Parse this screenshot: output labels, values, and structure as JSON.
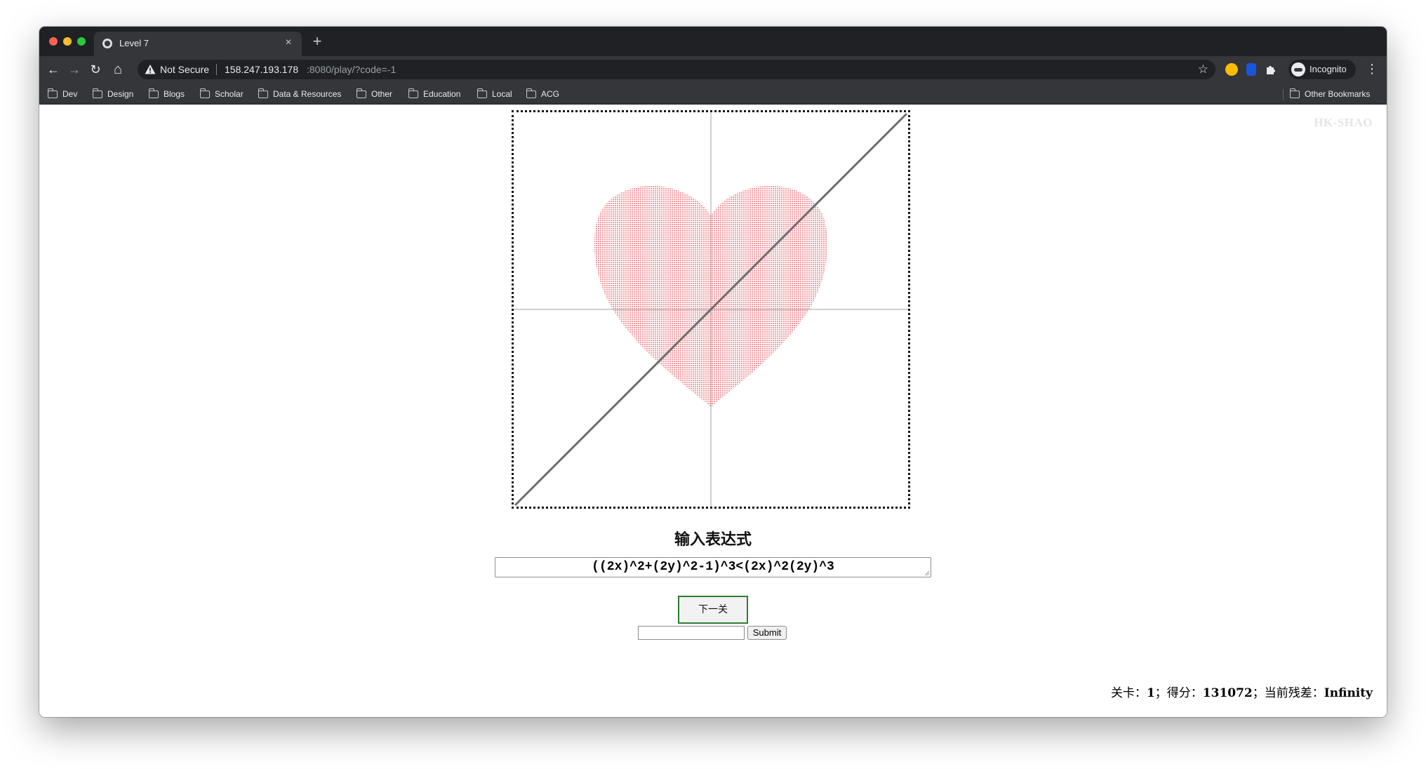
{
  "tab": {
    "title": "Level 7",
    "close_glyph": "×",
    "new_tab_glyph": "+"
  },
  "toolbar": {
    "back_glyph": "←",
    "forward_glyph": "→",
    "reload_glyph": "↻",
    "home_glyph": "⌂",
    "security_label": "Not Secure",
    "url_host": "158.247.193.178",
    "url_rest": ":8080/play/?code=-1",
    "star_glyph": "☆",
    "profile_label": "Incognito",
    "menu_glyph": "⋮"
  },
  "bookmarks": {
    "items": [
      "Dev",
      "Design",
      "Blogs",
      "Scholar",
      "Data & Resources",
      "Other",
      "Education",
      "Local",
      "ACG"
    ],
    "other_bookmarks": "Other Bookmarks"
  },
  "page": {
    "watermark": "HK-SHAO",
    "prompt_title": "输入表达式",
    "expression_value": "((2x)^2+(2y)^2-1)^3<(2x)^2(2y)^3",
    "next_level_button": "下一关",
    "code_input_value": "",
    "submit_button": "Submit",
    "status": {
      "level_label": "关卡：",
      "level_value": "1",
      "score_label": "；得分：",
      "score_value": "131072",
      "residual_label": "；当前残差：",
      "residual_value": "Infinity"
    }
  },
  "colors": {
    "heart_fill": "#f4a3a8",
    "axis_line": "#9e9e9e",
    "diagonal_line": "#6e6e6e",
    "next_button_border": "#2e7d32",
    "browser_dark": "#202124",
    "browser_toolbar": "#35363a"
  },
  "icons": {
    "security": "warning-triangle-icon",
    "tab_favicon": "globe-icon",
    "bookmark": "folder-icon"
  }
}
